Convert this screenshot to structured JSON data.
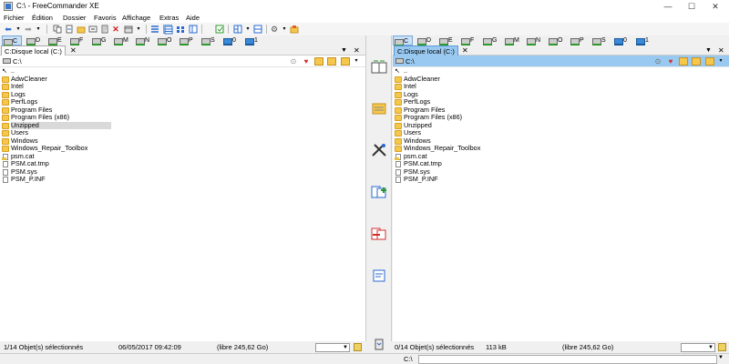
{
  "window": {
    "title": "C:\\ - FreeCommander XE",
    "minimize_glyph": "—",
    "maximize_glyph": "☐",
    "close_glyph": "✕"
  },
  "menu": [
    "Fichier",
    "Édition",
    "Dossier",
    "Favoris",
    "Affichage",
    "Extras",
    "Aide"
  ],
  "toolbar_icons": [
    "back-arrow-icon",
    "forward-arrow-icon",
    "copy-icon",
    "move-icon",
    "new-folder-icon",
    "rename-icon",
    "delete-icon",
    "pack-icon",
    "view-list-icon",
    "view-details-icon",
    "view-thumbnails-icon",
    "view-tree-icon",
    "sync-icon",
    "layout-icon",
    "layout-vertical-icon",
    "settings-icon",
    "favorite-folder-icon"
  ],
  "drives": [
    "C",
    "D",
    "E",
    "F",
    "G",
    "M",
    "N",
    "O",
    "P",
    "S",
    "0",
    "1"
  ],
  "left_pane": {
    "tab_label": "C:Disque local (C:)",
    "close_glyph": "✕",
    "menu_glyph": "▼",
    "path": "C:\\",
    "files": [
      {
        "name": "..",
        "type": "up"
      },
      {
        "name": "AdwCleaner",
        "type": "folder"
      },
      {
        "name": "Intel",
        "type": "folder"
      },
      {
        "name": "Logs",
        "type": "folder"
      },
      {
        "name": "PerfLogs",
        "type": "folder"
      },
      {
        "name": "Program Files",
        "type": "folder"
      },
      {
        "name": "Program Files (x86)",
        "type": "folder"
      },
      {
        "name": "Unzipped",
        "type": "folder",
        "selected": true
      },
      {
        "name": "Users",
        "type": "folder"
      },
      {
        "name": "Windows",
        "type": "folder"
      },
      {
        "name": "Windows_Repair_Toolbox",
        "type": "folder"
      },
      {
        "name": "psm.cat",
        "type": "cat"
      },
      {
        "name": "PSM.cat.tmp",
        "type": "file"
      },
      {
        "name": "PSM.sys",
        "type": "file"
      },
      {
        "name": "PSM_P.INF",
        "type": "file"
      }
    ],
    "status": {
      "selection": "1/14 Objet(s) sélectionnés",
      "date": "06/05/2017 09:42:09",
      "free": "(libre 245,62 Go)"
    }
  },
  "right_pane": {
    "tab_label": "C:Disque local (C:)",
    "close_glyph": "✕",
    "menu_glyph": "▼",
    "path": "C:\\",
    "files": [
      {
        "name": "..",
        "type": "up"
      },
      {
        "name": "AdwCleaner",
        "type": "folder"
      },
      {
        "name": "Intel",
        "type": "folder"
      },
      {
        "name": "Logs",
        "type": "folder"
      },
      {
        "name": "PerfLogs",
        "type": "folder"
      },
      {
        "name": "Program Files",
        "type": "folder"
      },
      {
        "name": "Program Files (x86)",
        "type": "folder"
      },
      {
        "name": "Unzipped",
        "type": "folder"
      },
      {
        "name": "Users",
        "type": "folder"
      },
      {
        "name": "Windows",
        "type": "folder"
      },
      {
        "name": "Windows_Repair_Toolbox",
        "type": "folder"
      },
      {
        "name": "psm.cat",
        "type": "cat"
      },
      {
        "name": "PSM.cat.tmp",
        "type": "file"
      },
      {
        "name": "PSM.sys",
        "type": "file"
      },
      {
        "name": "PSM_P.INF",
        "type": "file"
      }
    ],
    "status": {
      "selection": "0/14 Objet(s) sélectionnés",
      "size": "113 kB",
      "free": "(libre 245,62 Go)"
    }
  },
  "middle_icons": [
    "swap-panes-icon",
    "folder-compare-icon",
    "tools-icon",
    "copy-to-right-icon",
    "copy-to-left-icon",
    "view-file-icon",
    "recycle-icon"
  ],
  "cmdline": {
    "label": "C:\\",
    "value": "",
    "drop_glyph": "▼"
  },
  "colors": {
    "active_tab": "#99c9f0",
    "folder": "#f5c84c",
    "selection": "#d9d9d9"
  }
}
